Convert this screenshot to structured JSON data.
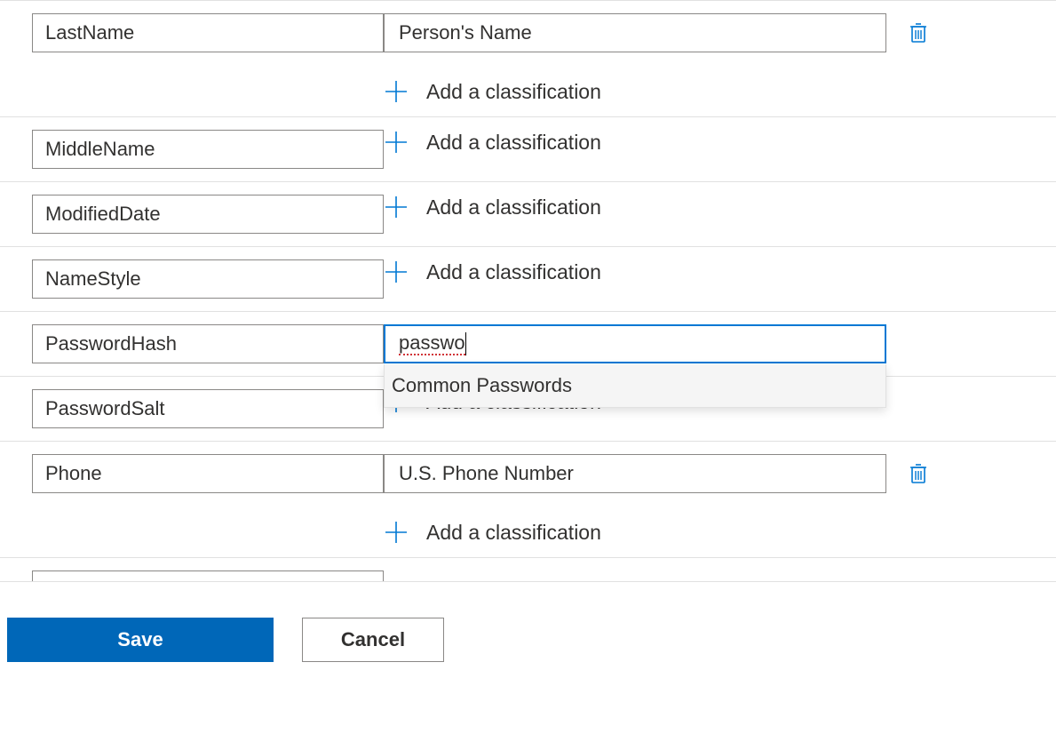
{
  "addClassificationLabel": "Add a classification",
  "suggestion": "Common Passwords",
  "rows": {
    "lastName": {
      "name": "LastName",
      "classification": "Person's Name"
    },
    "middleName": {
      "name": "MiddleName"
    },
    "modifiedDate": {
      "name": "ModifiedDate"
    },
    "nameStyle": {
      "name": "NameStyle"
    },
    "passwordHash": {
      "name": "PasswordHash",
      "typed": "passwo"
    },
    "passwordSalt": {
      "name": "PasswordSalt"
    },
    "phone": {
      "name": "Phone",
      "classification": "U.S. Phone Number"
    }
  },
  "buttons": {
    "save": "Save",
    "cancel": "Cancel"
  }
}
